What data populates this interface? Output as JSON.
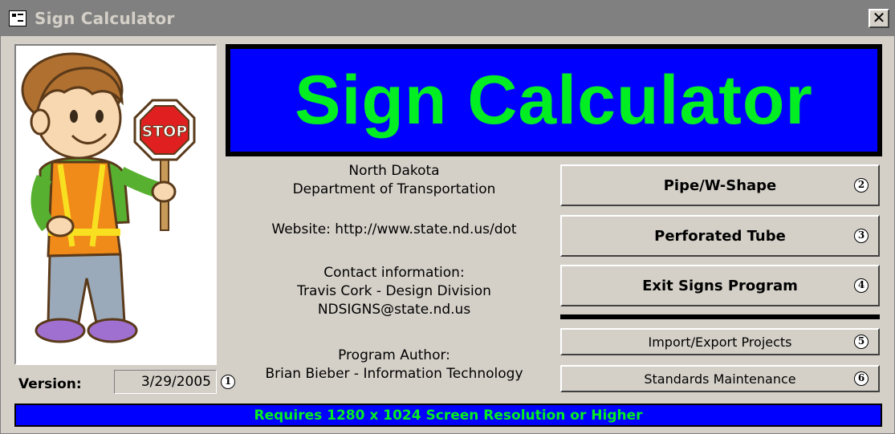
{
  "window": {
    "title": "Sign Calculator",
    "close_label": "✕"
  },
  "banner": {
    "title": "Sign Calculator"
  },
  "info": {
    "org_line1": "North Dakota",
    "org_line2": "Department of Transportation",
    "website": "Website: http://www.state.nd.us/dot",
    "contact_heading": "Contact information:",
    "contact_name": "Travis Cork - Design Division",
    "contact_email": "NDSIGNS@state.nd.us",
    "author_heading": "Program Author:",
    "author_name": "Brian Bieber - Information Technology"
  },
  "buttons": [
    {
      "label": "Pipe/W-Shape",
      "number": "2"
    },
    {
      "label": "Perforated Tube",
      "number": "3"
    },
    {
      "label": "Exit Signs Program",
      "number": "4"
    },
    {
      "label": "Import/Export Projects",
      "number": "5"
    },
    {
      "label": "Standards Maintenance",
      "number": "6"
    }
  ],
  "version": {
    "label": "Version:",
    "value": "3/29/2005",
    "number": "1"
  },
  "stop_sign": {
    "text": "STOP"
  },
  "footer": {
    "text": "Requires 1280 x 1024 Screen Resolution or Higher"
  },
  "colors": {
    "banner_bg": "#0000ff",
    "banner_text": "#00ee22",
    "window_bg": "#d4d0c8",
    "titlebar": "#808080"
  }
}
